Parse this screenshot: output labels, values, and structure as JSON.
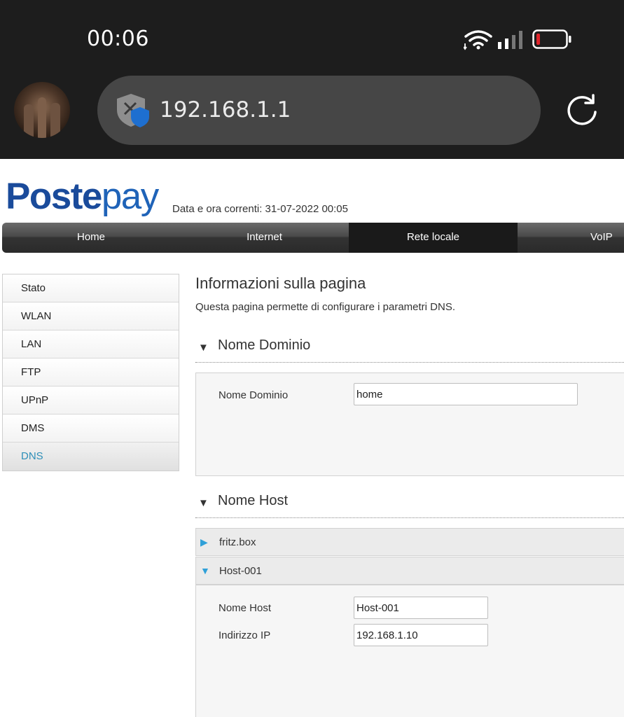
{
  "status_bar": {
    "time": "00:06"
  },
  "browser": {
    "url": "192.168.1.1"
  },
  "header": {
    "logo_post": "Poste",
    "logo_pay": "pay",
    "datetime": "Data e ora correnti: 31-07-2022 00:05"
  },
  "nav": {
    "items": [
      "Home",
      "Internet",
      "Rete locale",
      "VoIP"
    ],
    "active": "Rete locale"
  },
  "sidebar": {
    "items": [
      "Stato",
      "WLAN",
      "LAN",
      "FTP",
      "UPnP",
      "DMS",
      "DNS"
    ],
    "active": "DNS"
  },
  "main": {
    "title": "Informazioni sulla pagina",
    "description": "Questa pagina permette di configurare i parametri DNS.",
    "domain_section": {
      "heading": "Nome Dominio",
      "field_label": "Nome Dominio",
      "field_value": "home"
    },
    "host_section": {
      "heading": "Nome Host",
      "hosts": [
        {
          "name": "fritz.box",
          "expanded": false
        },
        {
          "name": "Host-001",
          "expanded": true
        }
      ],
      "host_name_label": "Nome Host",
      "host_name_value": "Host-001",
      "ip_label": "Indirizzo IP",
      "ip_value": "192.168.1.10"
    }
  },
  "colors": {
    "logo_blue": "#1a4b9b",
    "active_link": "#2e8fb8",
    "expand_arrow": "#2fa0d8",
    "battery_low": "#e0252b"
  }
}
